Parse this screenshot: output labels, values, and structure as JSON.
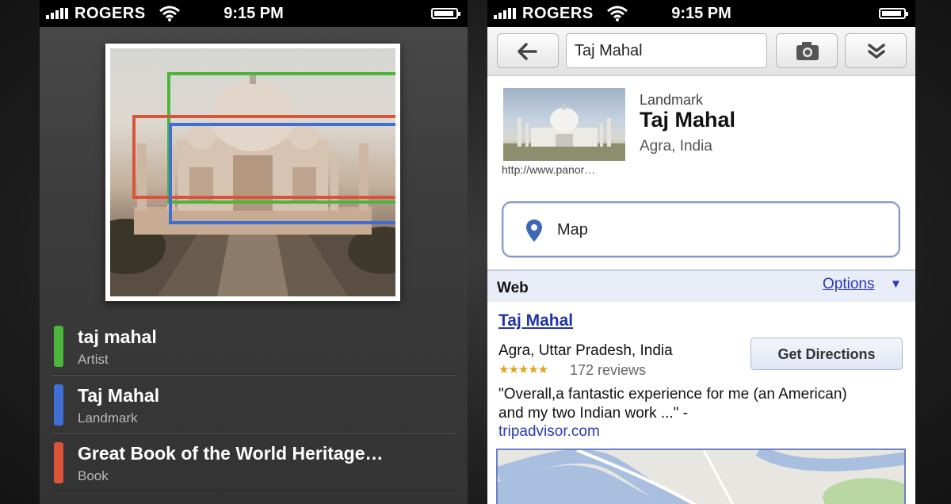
{
  "status_bar": {
    "carrier": "ROGERS",
    "time": "9:15 PM"
  },
  "left_screen": {
    "detection_colors": {
      "green": "#4cb63c",
      "red": "#d9553a",
      "blue": "#3f6fd3"
    },
    "results": [
      {
        "title": "taj mahal",
        "subtitle": "Artist",
        "color": "#4cb63c"
      },
      {
        "title": "Taj Mahal",
        "subtitle": "Landmark",
        "color": "#3f6fd3"
      },
      {
        "title": "Great Book of the World Heritage…",
        "subtitle": "Book",
        "color": "#d9553a"
      }
    ]
  },
  "right_screen": {
    "toolbar": {
      "back_icon": "arrow-left-icon",
      "search_value": "Taj Mahal",
      "camera_icon": "camera-icon",
      "more_icon": "double-chevron-down-icon"
    },
    "entity": {
      "type": "Landmark",
      "title": "Taj Mahal",
      "location": "Agra, India",
      "thumb_url": "http://www.panor…"
    },
    "map_button": {
      "label": "Map",
      "icon": "map-pin-icon"
    },
    "web_section": {
      "heading": "Web",
      "options_label": "Options",
      "caret": "▼"
    },
    "web_result": {
      "title": "Taj Mahal",
      "address": "Agra, Uttar Pradesh, India",
      "stars": "★★★★★",
      "rating": 4.5,
      "reviews": "172 reviews",
      "directions_label": "Get Directions",
      "snippet": "\"Overall,a fantastic experience for me (an American) and my two Indian work ...\" -",
      "source": "tripadvisor.com"
    },
    "accent_link_color": "#2a39b8"
  }
}
